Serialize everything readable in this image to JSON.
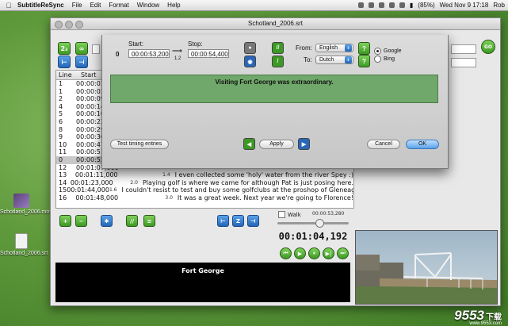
{
  "menubar": {
    "apple": "",
    "app": "SubtitleReSync",
    "menus": [
      "File",
      "Edit",
      "Format",
      "Window",
      "Help"
    ],
    "battery": "(85%)",
    "clock": "Wed Nov 9  17:18",
    "user": "Rob"
  },
  "desktop": {
    "icon1_label": "Schotland_2006.mov",
    "icon2_label": "Schotland_2006.srt"
  },
  "window": {
    "title": "Schotland_2006.srt"
  },
  "table": {
    "headers": [
      "Line",
      "Start"
    ],
    "rows": [
      {
        "line": "1",
        "start": "00:00:02,",
        "dur": "",
        "text": ""
      },
      {
        "line": "1",
        "start": "00:00:02,",
        "dur": "",
        "text": ""
      },
      {
        "line": "2",
        "start": "00:00:09,",
        "dur": "",
        "text": ""
      },
      {
        "line": "4",
        "start": "00:00:14,",
        "dur": "",
        "text": ""
      },
      {
        "line": "5",
        "start": "00:00:16,",
        "dur": "",
        "text": ""
      },
      {
        "line": "6",
        "start": "00:00:22,",
        "dur": "",
        "text": ""
      },
      {
        "line": "8",
        "start": "00:00:29,",
        "dur": "",
        "text": ""
      },
      {
        "line": "9",
        "start": "00:00:36,",
        "dur": "",
        "text": ""
      },
      {
        "line": "10",
        "start": "00:00:47,",
        "dur": "",
        "text": ""
      },
      {
        "line": "11",
        "start": "00:00:51,",
        "dur": "",
        "text": ""
      },
      {
        "line": "0",
        "start": "00:00:53,",
        "dur": "",
        "text": ""
      },
      {
        "line": "12",
        "start": "00:01:07,000",
        "dur": "",
        "text": ""
      },
      {
        "line": "13",
        "start": "00:01:11,000",
        "dur": "1.4",
        "text": "I even collected some 'holy' water from the river Spey :)"
      },
      {
        "line": "14",
        "start": "00:01:23,000",
        "dur": "2.0",
        "text": "Playing golf is where we came for although Pat is just posing here."
      },
      {
        "line": "15",
        "start": "00:01:44,000",
        "dur": "1.6",
        "text": "I couldn't resist to test and buy some golfclubs at the proshop of Gleneagles."
      },
      {
        "line": "16",
        "start": "00:01:48,000",
        "dur": "3.0",
        "text": "It was a great week. Next year we're going to Florence!"
      }
    ]
  },
  "player": {
    "walk_label": "Walk",
    "small_time": "00:00:53,280",
    "timecode": "00:01:04,192",
    "preview_text": "Fort George"
  },
  "sheet": {
    "start_label": "Start:",
    "stop_label": "Stop:",
    "index": "0",
    "start_value": "00:00:53,200",
    "stop_value": "00:00:54,400",
    "ratio": "1.2",
    "from_label": "From:",
    "to_label": "To:",
    "from_lang": "English",
    "to_lang": "Dutch",
    "engine_google": "Google",
    "engine_bing": "Bing",
    "subtitle_text": "Visiting Fort George was extraordinary.",
    "test_timing": "Test timing entries",
    "apply": "Apply",
    "cancel": "Cancel",
    "ok": "OK"
  },
  "watermark": {
    "brand": "9553",
    "brand_suffix": "下载",
    "url": "www.9553.com"
  },
  "colors": {
    "accent_green": "#3c9a24",
    "accent_blue": "#2466b8",
    "subtitle_area": "#6fa86a"
  }
}
